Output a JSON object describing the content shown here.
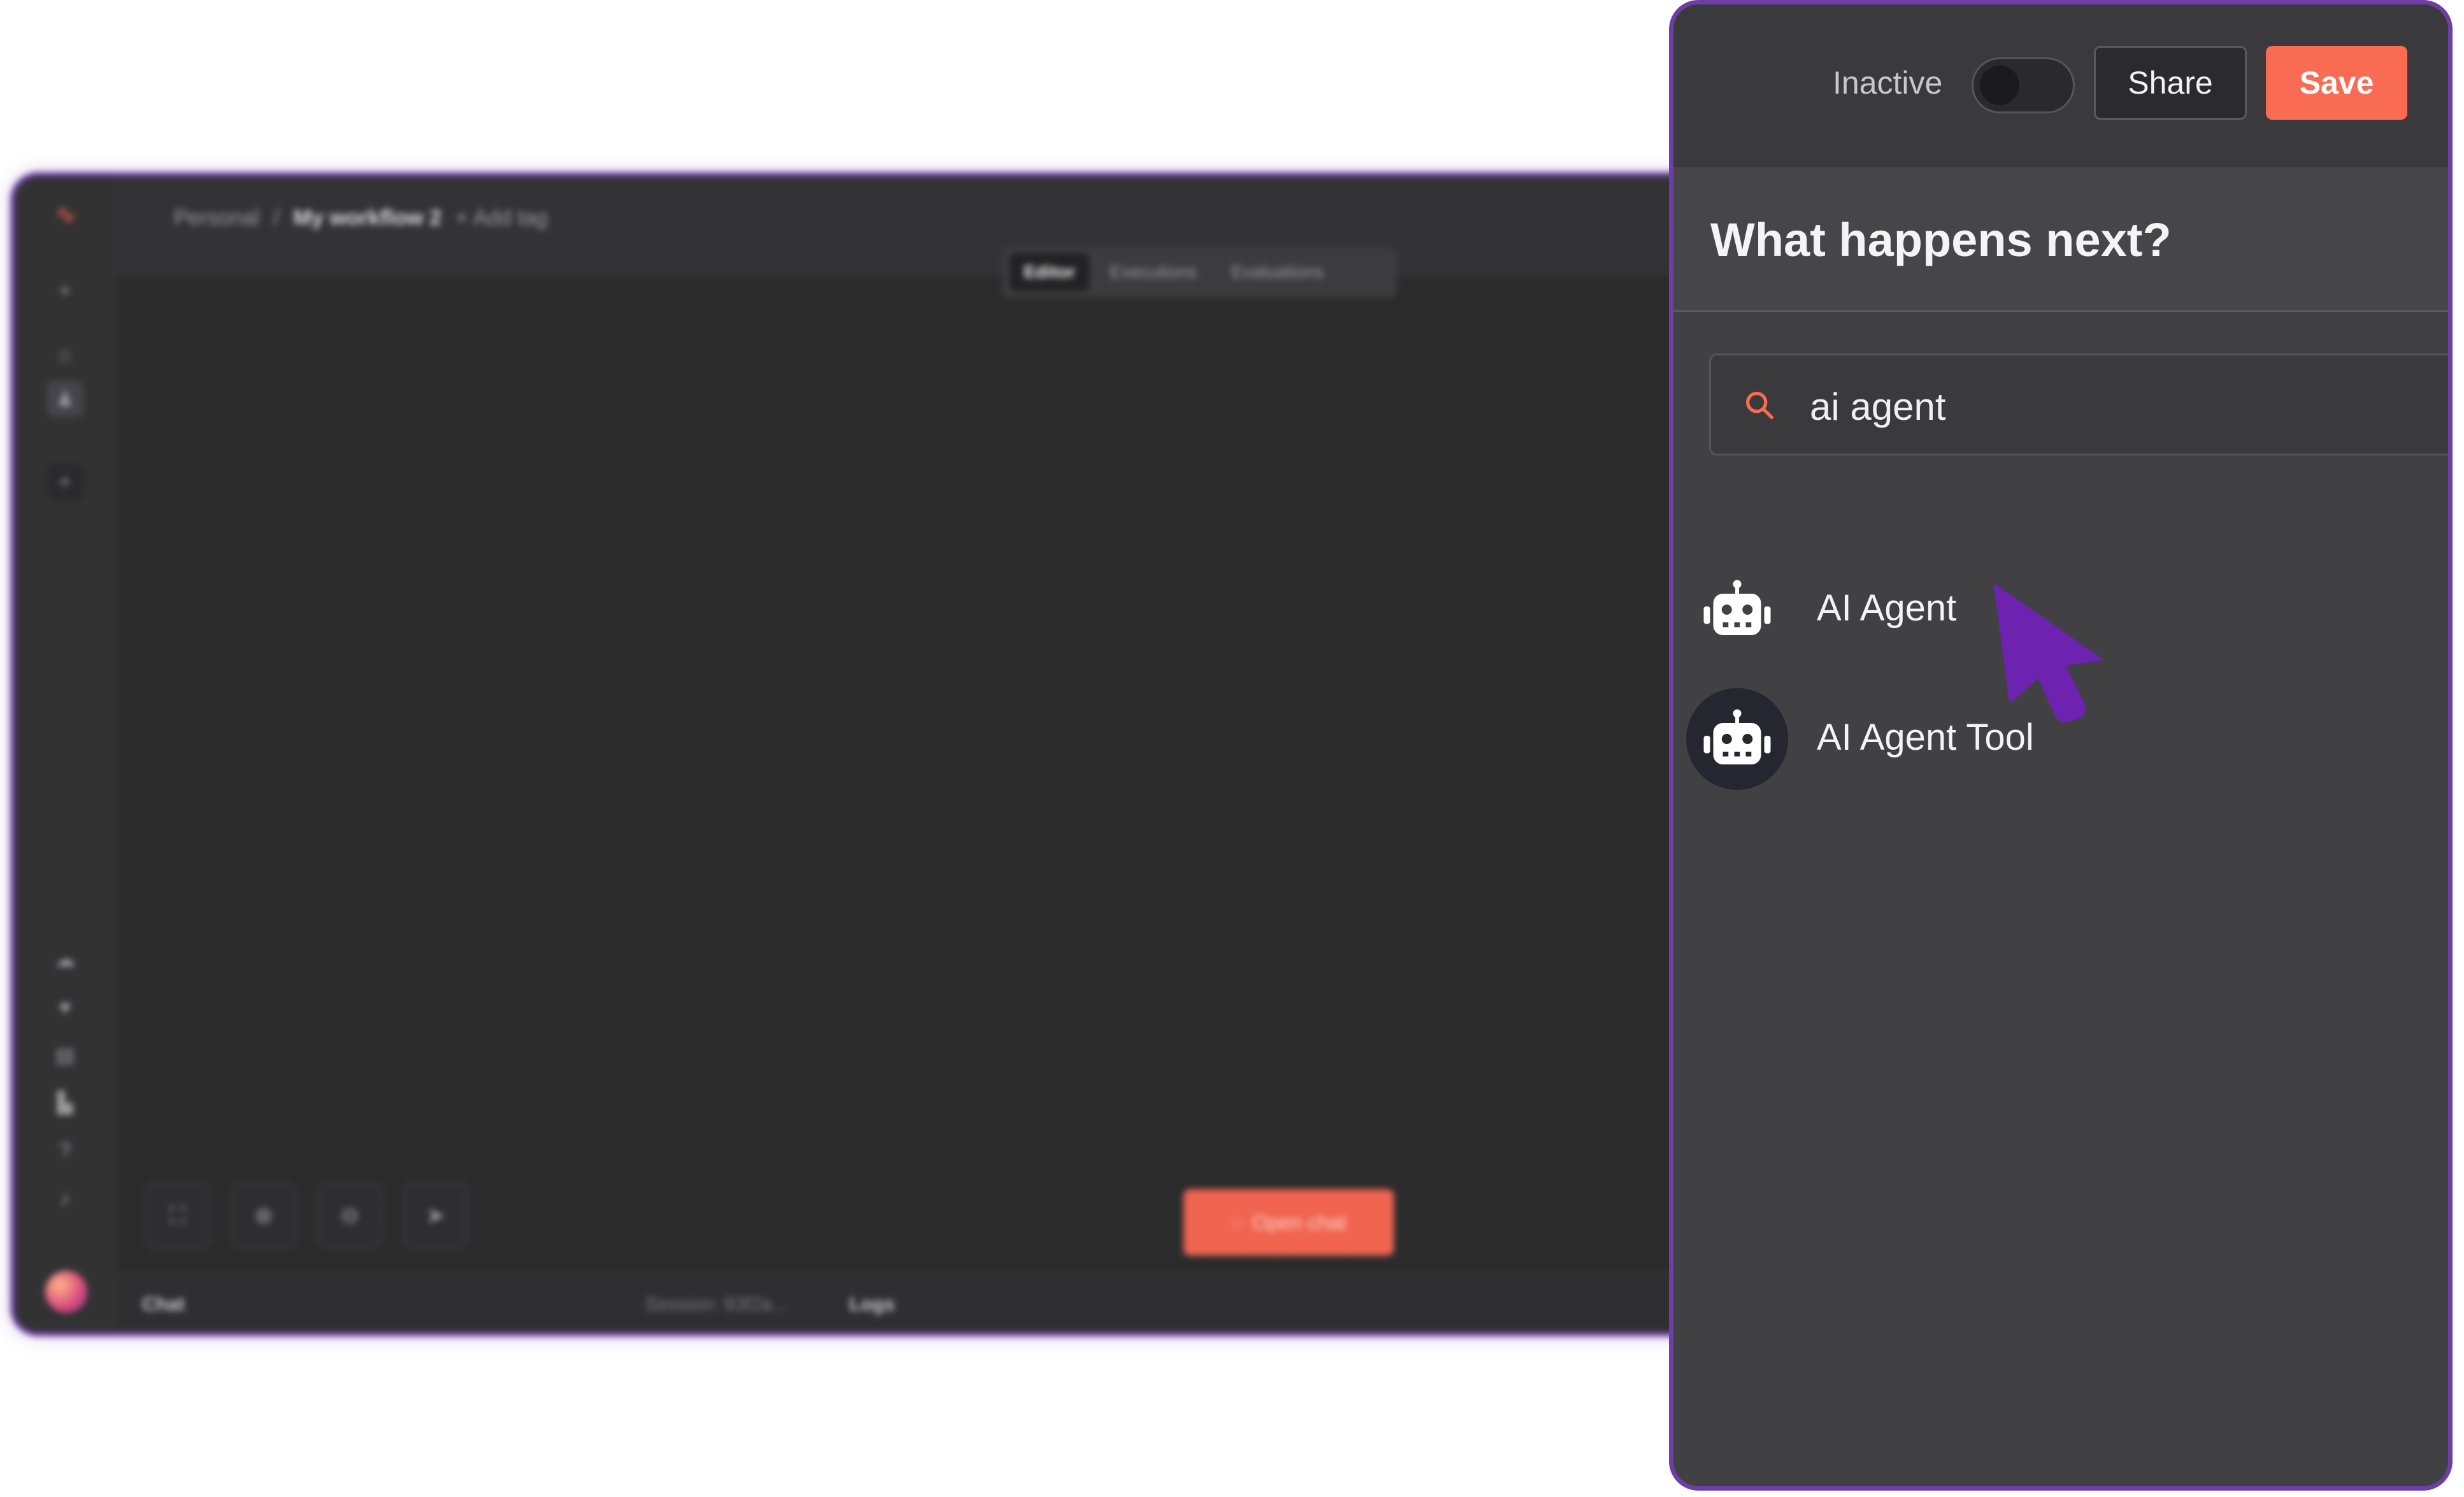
{
  "background_editor": {
    "breadcrumb": {
      "project": "Personal",
      "separator": "/",
      "workflow": "My workflow 2",
      "add_tag": "+ Add tag"
    },
    "tabs": [
      {
        "label": "Editor",
        "active": true
      },
      {
        "label": "Executions",
        "active": false
      },
      {
        "label": "Evaluations",
        "active": false
      }
    ],
    "open_chat_label": "Open chat",
    "bottom_bar": {
      "chat": "Chat",
      "session": "Session: 93f2a...",
      "logs": "Logs"
    }
  },
  "panel": {
    "status_label": "Inactive",
    "active_toggle": false,
    "share_label": "Share",
    "save_label": "Save",
    "title": "What happens next?",
    "search": {
      "value": "ai agent",
      "icon": "search-icon"
    },
    "results": [
      {
        "label": "AI Agent",
        "icon": "robot-icon",
        "hovered": false
      },
      {
        "label": "AI Agent Tool",
        "icon": "robot-icon",
        "hovered": true
      }
    ]
  },
  "colors": {
    "accent": "#fa6b54",
    "frame": "#6d3fa6",
    "cursor": "#6d22b0",
    "panel_bg": "#414143"
  }
}
